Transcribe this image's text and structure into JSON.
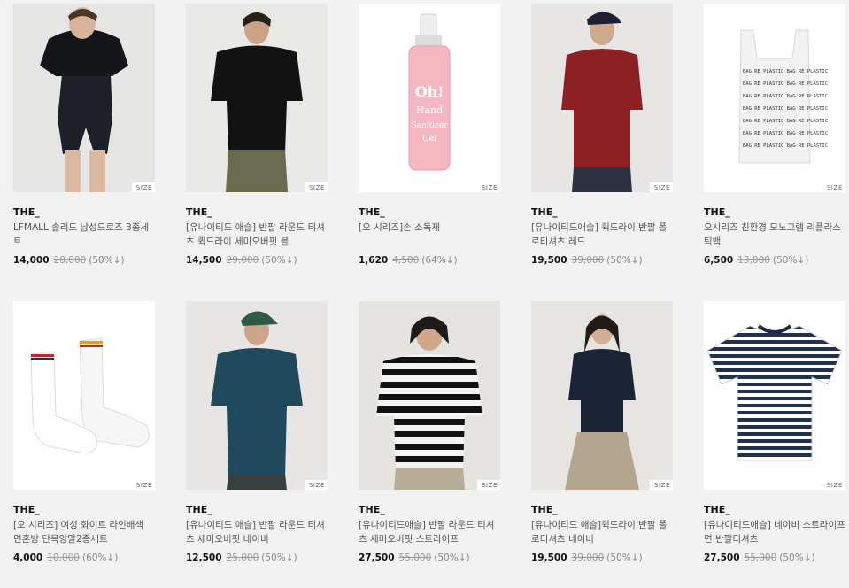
{
  "size_label": "SIZE",
  "products": [
    {
      "brand": "THE_",
      "name": "LFMALL 솔리드 남성드로즈 3종세트",
      "sale": "14,000",
      "orig": "28,000",
      "discount": "(50%↓)",
      "image": "model-black-polo-underwear"
    },
    {
      "brand": "THE_",
      "name": "[유나이티드 애슬] 반팔 라운드 티셔츠 퀵드라이 세미오버핏 블",
      "sale": "14,500",
      "orig": "29,000",
      "discount": "(50%↓)",
      "image": "model-black-tshirt"
    },
    {
      "brand": "THE_",
      "name": "[오 시리즈]손 소독제",
      "sale": "1,620",
      "orig": "4,500",
      "discount": "(64%↓)",
      "image": "hand-sanitizer-bottle"
    },
    {
      "brand": "THE_",
      "name": "[유나이티드애슬] 퀵드라이 반팔 폴로티셔츠 레드",
      "sale": "19,500",
      "orig": "39,000",
      "discount": "(50%↓)",
      "image": "model-red-polo"
    },
    {
      "brand": "THE_",
      "name": "오시리즈 친환경 모노그램 리플라스틱백",
      "sale": "6,500",
      "orig": "13,000",
      "discount": "(50%↓)",
      "image": "plastic-bag"
    },
    {
      "brand": "THE_",
      "name": "[오 시리즈] 여성 화이트 라인배색 면혼방 단목양말2종세트",
      "sale": "4,000",
      "orig": "10,000",
      "discount": "(60%↓)",
      "image": "white-socks"
    },
    {
      "brand": "THE_",
      "name": "[유나이티드 애슬] 반팔 라운드 티셔츠 세미오버핏 네이비",
      "sale": "12,500",
      "orig": "25,000",
      "discount": "(50%↓)",
      "image": "model-navy-tshirt"
    },
    {
      "brand": "THE_",
      "name": "[유나이티드애슬] 반팔 라운드 티셔츠 세미오버핏 스트라이프",
      "sale": "27,500",
      "orig": "55,000",
      "discount": "(50%↓)",
      "image": "model-striped-tshirt"
    },
    {
      "brand": "THE_",
      "name": "[유나이티드 애슬]퀵드라이 반팔 폴로티셔츠 네이비",
      "sale": "19,500",
      "orig": "39,000",
      "discount": "(50%↓)",
      "image": "model-navy-polo"
    },
    {
      "brand": "THE_",
      "name": "[유나이티드애슬] 네이비 스트라이프 면 반팔티셔츠",
      "sale": "27,500",
      "orig": "55,000",
      "discount": "(50%↓)",
      "image": "striped-tshirt-flat"
    }
  ],
  "sanitizer_label": [
    "Oh!",
    "Hand",
    "Sanitizer",
    "Gel"
  ],
  "bag_print": "BAG RE PLASTIC BAG RE PLASTIC"
}
